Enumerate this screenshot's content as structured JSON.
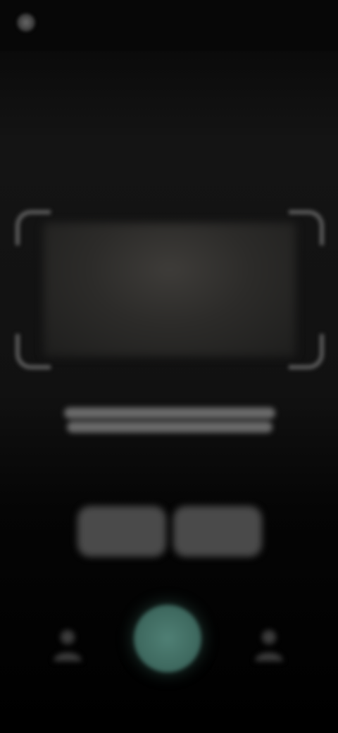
{
  "header": {
    "back_label": ""
  },
  "scanner": {
    "instruction": ""
  },
  "modes": [
    {
      "label": ""
    },
    {
      "label": ""
    }
  ],
  "bottom_bar": {
    "left_icon": "person-icon",
    "right_icon": "person-icon",
    "shutter_color": "#4f7f74"
  },
  "colors": {
    "background": "#0b0b0b",
    "accent": "#4f7f74"
  }
}
